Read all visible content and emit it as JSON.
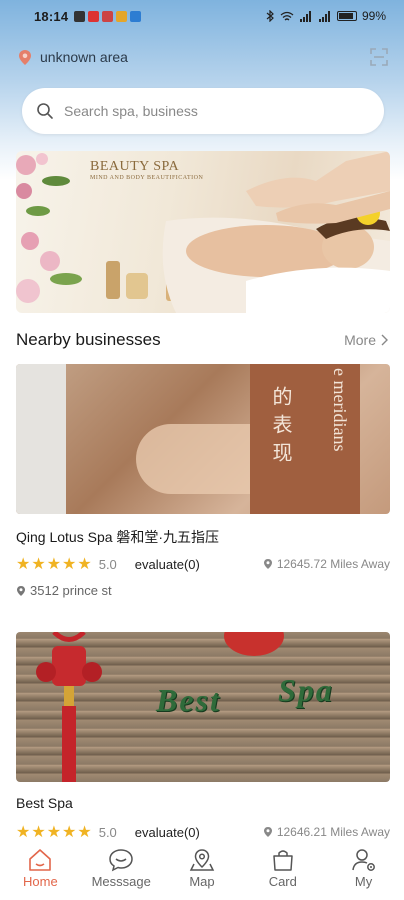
{
  "status_bar": {
    "time": "18:14",
    "battery": "99%"
  },
  "header": {
    "location": "unknown area"
  },
  "search": {
    "placeholder": "Search spa, business"
  },
  "banner": {
    "title": "BEAUTY SPA",
    "subtitle": "MIND AND BODY BEAUTIFICATION"
  },
  "nearby": {
    "title": "Nearby businesses",
    "more_label": "More"
  },
  "businesses": [
    {
      "name": "Qing Lotus Spa 磐和堂·九五指压",
      "stars": "★★★★★",
      "rating": "5.0",
      "evaluate": "evaluate(0)",
      "distance": "12645.72 Miles Away",
      "address": "3512 prince st",
      "image_text_cn": "的表现",
      "image_text_en": "e meridians"
    },
    {
      "name": "Best Spa",
      "stars": "★★★★★",
      "rating": "5.0",
      "evaluate": "evaluate(0)",
      "distance": "12646.21 Miles Away",
      "image_text_1": "Best",
      "image_text_2": "Spa"
    }
  ],
  "tabbar": {
    "items": [
      {
        "label": "Home",
        "icon": "home-icon",
        "active": true
      },
      {
        "label": "Messsage",
        "icon": "message-icon",
        "active": false
      },
      {
        "label": "Map",
        "icon": "map-icon",
        "active": false
      },
      {
        "label": "Card",
        "icon": "card-icon",
        "active": false
      },
      {
        "label": "My",
        "icon": "profile-icon",
        "active": false
      }
    ]
  },
  "colors": {
    "accent": "#e2664a",
    "star": "#f0b323",
    "location_pin": "#e57f6a"
  }
}
